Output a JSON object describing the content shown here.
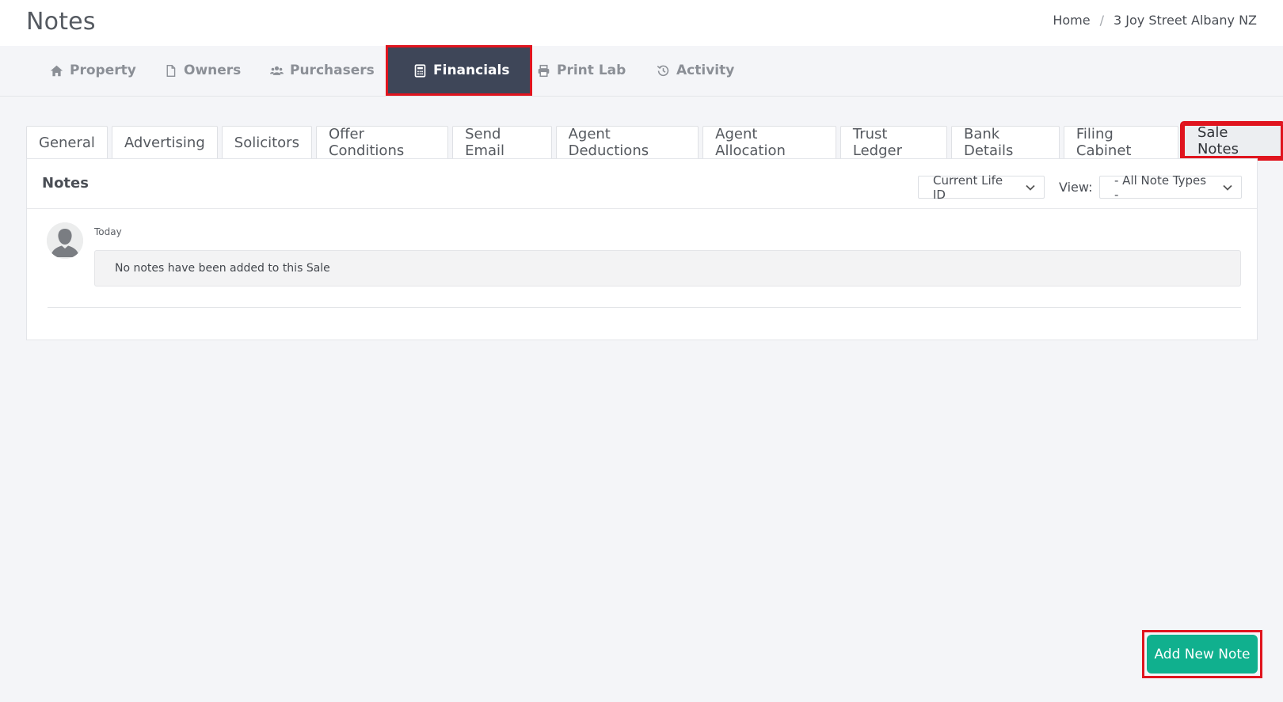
{
  "header": {
    "title": "Notes",
    "breadcrumb": [
      {
        "label": "Home"
      },
      {
        "label": "3 Joy Street Albany NZ"
      }
    ],
    "separator": "/"
  },
  "main_nav": {
    "tabs": [
      {
        "label": "Property",
        "icon": "home-icon",
        "active": false
      },
      {
        "label": "Owners",
        "icon": "file-icon",
        "active": false
      },
      {
        "label": "Purchasers",
        "icon": "users-icon",
        "active": false
      },
      {
        "label": "Financials",
        "icon": "calculator-icon",
        "active": true
      },
      {
        "label": "Print Lab",
        "icon": "printer-icon",
        "active": false
      },
      {
        "label": "Activity",
        "icon": "history-icon",
        "active": false
      }
    ]
  },
  "sub_tabs": [
    {
      "label": "General",
      "active": false
    },
    {
      "label": "Advertising",
      "active": false
    },
    {
      "label": "Solicitors",
      "active": false
    },
    {
      "label": "Offer Conditions",
      "active": false
    },
    {
      "label": "Send Email",
      "active": false
    },
    {
      "label": "Agent Deductions",
      "active": false
    },
    {
      "label": "Agent Allocation",
      "active": false
    },
    {
      "label": "Trust Ledger",
      "active": false
    },
    {
      "label": "Bank Details",
      "active": false
    },
    {
      "label": "Filing Cabinet",
      "active": false
    },
    {
      "label": "Sale Notes",
      "active": true
    }
  ],
  "panel": {
    "title": "Notes",
    "life_select": {
      "value": "Current Life ID"
    },
    "view_label": "View:",
    "view_select": {
      "value": "- All Note Types -"
    },
    "note": {
      "date": "Today",
      "text": "No notes have been added to this Sale"
    }
  },
  "actions": {
    "add_note_label": "Add New Note"
  },
  "colors": {
    "active_nav": "#3e4658",
    "highlight": "#e0141e",
    "primary_button": "#10b08e"
  }
}
